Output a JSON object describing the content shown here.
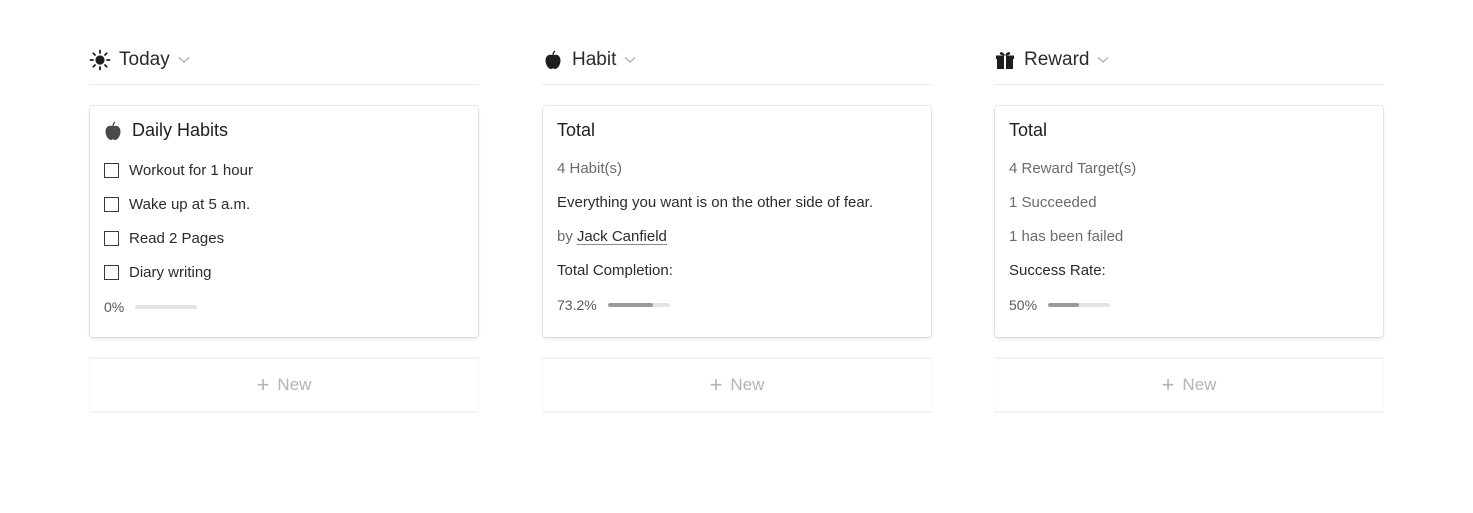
{
  "columns": {
    "today": {
      "title": "Today",
      "icon": "sun-icon",
      "card": {
        "title": "Daily Habits",
        "icon": "apple-icon",
        "checklist": [
          {
            "label": "Workout for 1 hour",
            "checked": false
          },
          {
            "label": "Wake up at 5 a.m.",
            "checked": false
          },
          {
            "label": "Read 2 Pages",
            "checked": false
          },
          {
            "label": "Diary writing",
            "checked": false
          }
        ],
        "progress_label": "0%",
        "progress_value": 0
      },
      "new_label": "New"
    },
    "habit": {
      "title": "Habit",
      "icon": "apple-icon",
      "card": {
        "title": "Total",
        "count": "4 Habit(s)",
        "quote": "Everything you want is on the other side of fear.",
        "by_prefix": "by",
        "author": "Jack Canfield",
        "completion_label": "Total Completion:",
        "progress_label": "73.2%",
        "progress_value": 73.2
      },
      "new_label": "New"
    },
    "reward": {
      "title": "Reward",
      "icon": "gift-icon",
      "card": {
        "title": "Total",
        "targets": "4 Reward Target(s)",
        "succeeded": "1 Succeeded",
        "failed": "1 has been failed",
        "rate_label": "Success Rate:",
        "progress_label": "50%",
        "progress_value": 50
      },
      "new_label": "New"
    }
  },
  "colors": {
    "progress_fill": "#9a9a9a",
    "progress_track": "#e3e3e3",
    "muted_text": "#6b6b6b"
  }
}
